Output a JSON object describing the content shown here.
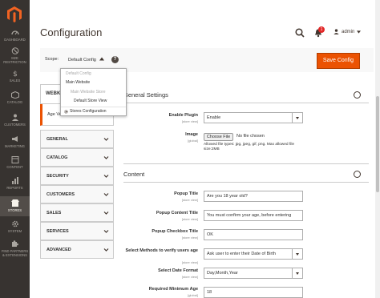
{
  "nav": {
    "items": [
      {
        "label": "DASHBOARD",
        "icon": "dashboard-icon"
      },
      {
        "label": "M2E RESTRICTION",
        "icon": "restriction-icon"
      },
      {
        "label": "SALES",
        "icon": "dollar-icon"
      },
      {
        "label": "CATALOG",
        "icon": "box-icon"
      },
      {
        "label": "CUSTOMERS",
        "icon": "person-icon"
      },
      {
        "label": "MARKETING",
        "icon": "megaphone-icon"
      },
      {
        "label": "CONTENT",
        "icon": "layout-icon"
      },
      {
        "label": "REPORTS",
        "icon": "bar-chart-icon"
      },
      {
        "label": "STORES",
        "icon": "store-icon"
      },
      {
        "label": "SYSTEM",
        "icon": "gear-icon"
      },
      {
        "label": "FIND PARTNERS & EXTENSIONS",
        "icon": "puzzle-icon"
      }
    ]
  },
  "header": {
    "title": "Configuration",
    "notification_count": "1",
    "user": "admin"
  },
  "scope": {
    "label": "Scope:",
    "current": "Default Config",
    "help": "?",
    "save_label": "Save Config",
    "dropdown": [
      "Default Config",
      "Main Website",
      "Main Website Store",
      "Default Store View",
      "Stores Configuration"
    ]
  },
  "tabs": {
    "head": "WEBKUL",
    "sub": "Age Verification",
    "rows": [
      "GENERAL",
      "CATALOG",
      "SECURITY",
      "CUSTOMERS",
      "SALES",
      "SERVICES",
      "ADVANCED"
    ]
  },
  "general_settings": {
    "title": "General Settings",
    "enable_plugin": {
      "label": "Enable Plugin",
      "scope": "[store view]",
      "value": "Enable"
    },
    "image": {
      "label": "Image",
      "scope": "[global]",
      "button": "Choose File",
      "status": "No file chosen",
      "note": "Allowed file types: jpg, jpeg, gif, png. Max allowed file size:2MB"
    }
  },
  "content": {
    "title": "Content",
    "fields": [
      {
        "label": "Popup Title",
        "scope": "[store view]",
        "value": "Are you 18 year old?"
      },
      {
        "label": "Popup Content Title",
        "scope": "[store view]",
        "value": "You must confirm your age, before entering"
      },
      {
        "label": "Popup Checkbox Title",
        "scope": "[store view]",
        "value": "OK"
      },
      {
        "label": "Select Methods to verify users age",
        "scope": "[store view]",
        "value": "Ask user to enter their Date of Birth"
      },
      {
        "label": "Select Date Format",
        "scope": "[store view]",
        "value": "Day,Month,Year"
      },
      {
        "label": "Required Minimum Age",
        "scope": "[global]",
        "value": "18"
      }
    ]
  },
  "colors": {
    "accent": "#eb5202",
    "nav_bg": "#373330"
  }
}
